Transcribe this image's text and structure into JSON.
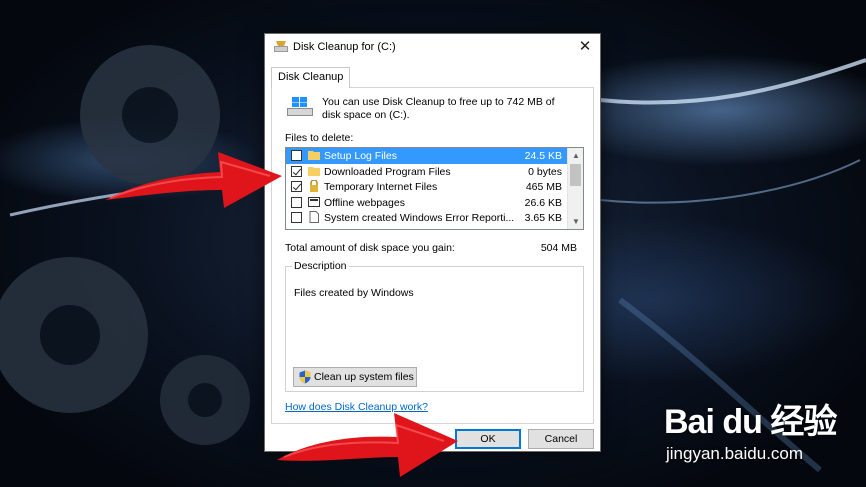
{
  "window": {
    "title": "Disk Cleanup for  (C:)",
    "close_glyph": "✕",
    "tab_label": "Disk Cleanup"
  },
  "intro": {
    "text": "You can use Disk Cleanup to free up to 742 MB of disk space on  (C:).",
    "icon": "drive-icon"
  },
  "files": {
    "label": "Files to delete:",
    "items": [
      {
        "name": "Setup Log Files",
        "size": "24.5 KB",
        "checked": false,
        "selected": true,
        "icon": "folder-icon"
      },
      {
        "name": "Downloaded Program Files",
        "size": "0 bytes",
        "checked": true,
        "selected": false,
        "icon": "folder-icon"
      },
      {
        "name": "Temporary Internet Files",
        "size": "465 MB",
        "checked": true,
        "selected": false,
        "icon": "lock-icon"
      },
      {
        "name": "Offline webpages",
        "size": "26.6 KB",
        "checked": false,
        "selected": false,
        "icon": "webpage-icon"
      },
      {
        "name": "System created Windows Error Reporti...",
        "size": "3.65 KB",
        "checked": false,
        "selected": false,
        "icon": "document-icon"
      }
    ]
  },
  "total": {
    "label": "Total amount of disk space you gain:",
    "value": "504 MB"
  },
  "description": {
    "legend": "Description",
    "text": "Files created by Windows"
  },
  "buttons": {
    "cleanup_system": "Clean up system files",
    "help_link": "How does Disk Cleanup work?",
    "ok": "OK",
    "cancel": "Cancel"
  },
  "watermark": {
    "logo": "Bai du 经验",
    "url": "jingyan.baidu.com"
  },
  "colors": {
    "selection": "#3399ff",
    "link": "#0066cc",
    "accent": "#0078d7",
    "arrow_red": "#e0141b"
  }
}
